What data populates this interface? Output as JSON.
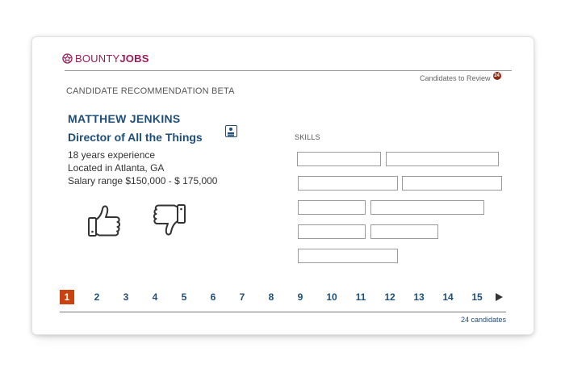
{
  "brand": {
    "name_part1": "BOUNTY",
    "name_part2": "JOBS",
    "color": "#9b1c5c"
  },
  "header": {
    "review_label": "Candidates to Review",
    "review_count": "24"
  },
  "section": {
    "title": "CANDIDATE RECOMMENDATION BETA"
  },
  "candidate": {
    "name": "MATTHEW JENKINS",
    "title": "Director of All the Things",
    "experience": "18 years experience",
    "location": "Located in Atlanta, GA",
    "salary": "Salary range $150,000 - $ 175,000"
  },
  "actions": {
    "thumbs_up_icon": "thumbs-up-icon",
    "thumbs_down_icon": "thumbs-down-icon"
  },
  "skills": {
    "label": "SKILLS",
    "item_count": 9
  },
  "pagination": {
    "pages": [
      "1",
      "2",
      "3",
      "4",
      "5",
      "6",
      "7",
      "8",
      "9",
      "10",
      "11",
      "12",
      "13",
      "14",
      "15"
    ],
    "current": "1",
    "next_icon": "play-arrow-icon"
  },
  "footer": {
    "count_label": "24 candidates"
  },
  "colors": {
    "primary_blue": "#1f4e79",
    "active_page": "#c9420f",
    "badge": "#8b2b14"
  }
}
